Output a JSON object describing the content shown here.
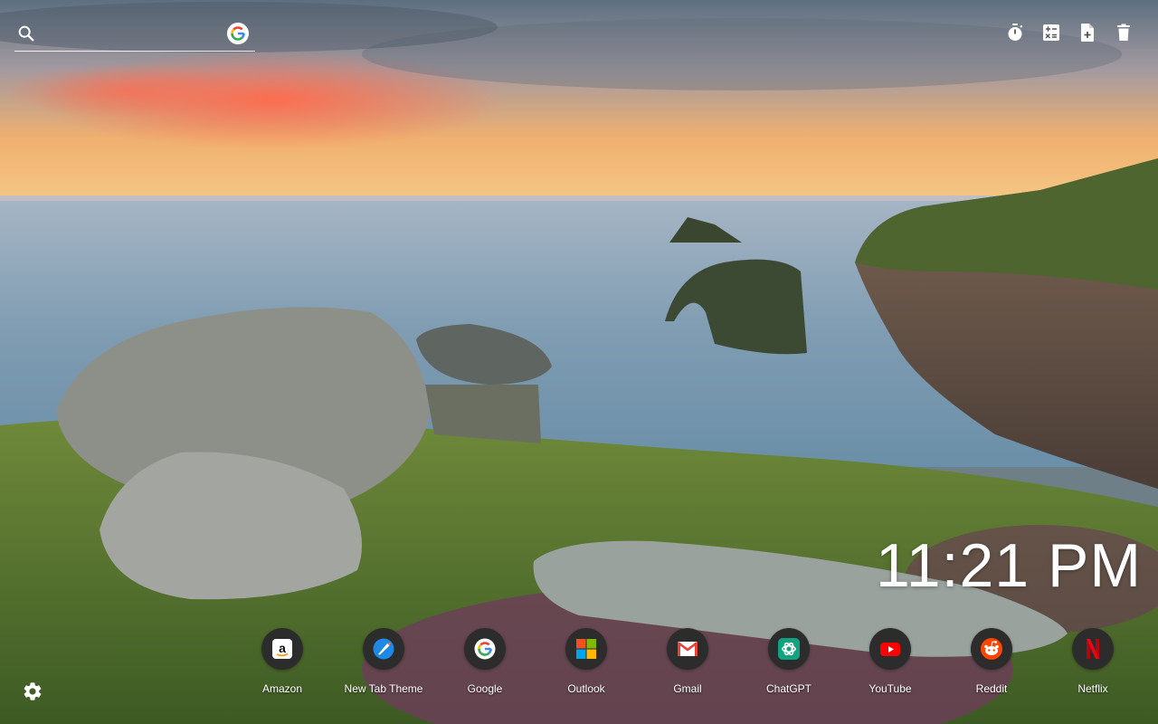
{
  "search": {
    "placeholder": ""
  },
  "toolbar": {
    "icons": [
      "timer-icon",
      "calculator-icon",
      "new-document-icon",
      "trash-icon"
    ]
  },
  "clock": {
    "time": "11:21 PM"
  },
  "shortcuts": [
    {
      "label": "Amazon",
      "icon": "amazon-icon"
    },
    {
      "label": "New Tab Theme",
      "icon": "new-tab-theme-icon"
    },
    {
      "label": "Google",
      "icon": "google-icon"
    },
    {
      "label": "Outlook",
      "icon": "outlook-icon"
    },
    {
      "label": "Gmail",
      "icon": "gmail-icon"
    },
    {
      "label": "ChatGPT",
      "icon": "chatgpt-icon"
    },
    {
      "label": "YouTube",
      "icon": "youtube-icon"
    },
    {
      "label": "Reddit",
      "icon": "reddit-icon"
    },
    {
      "label": "Netflix",
      "icon": "netflix-icon"
    }
  ],
  "colors": {
    "tile_bg": "#2c2c2c",
    "youtube_red": "#ff0000",
    "reddit_orange": "#ff4500",
    "netflix_red": "#e50914",
    "gmail_red": "#ea4335"
  }
}
